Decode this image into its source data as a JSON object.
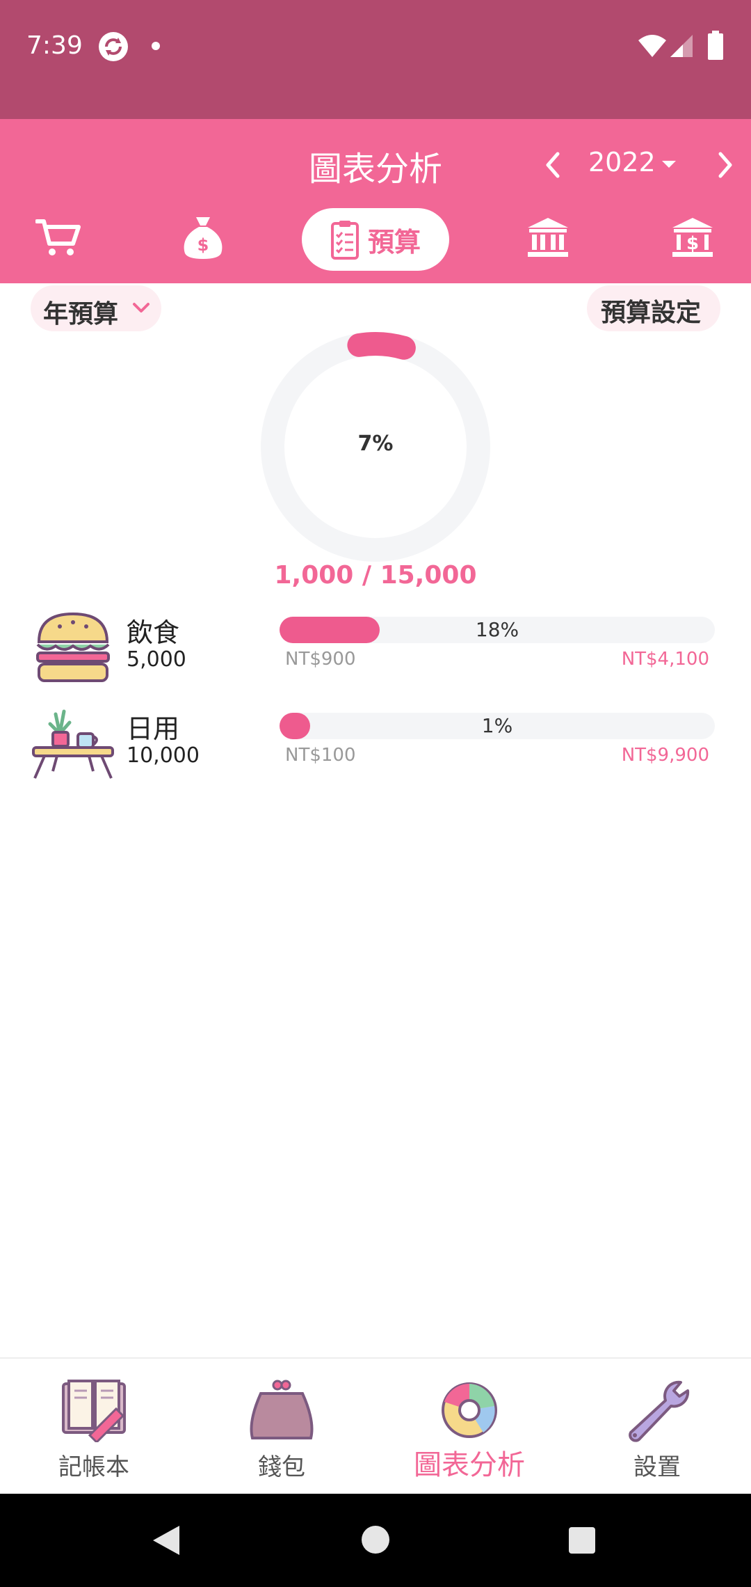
{
  "status_bar": {
    "time": "7:39"
  },
  "header": {
    "title": "圖表分析",
    "year": "2022",
    "tabs": [
      {
        "icon": "shopping-cart-icon"
      },
      {
        "icon": "money-bag-icon"
      },
      {
        "icon": "clipboard-checklist-icon",
        "label": "預算",
        "active": true
      },
      {
        "icon": "bank-icon"
      },
      {
        "icon": "bank-dollar-icon"
      }
    ]
  },
  "filter": {
    "period_label": "年預算",
    "settings_label": "預算設定"
  },
  "summary": {
    "percent_label": "7%",
    "percent": 0.07,
    "totals": "1,000 / 15,000"
  },
  "budgets": [
    {
      "icon": "burger-icon",
      "name": "飲食",
      "amount": "5,000",
      "percent_label": "18%",
      "fill": 0.23,
      "spent": "NT$900",
      "remaining": "NT$4,100"
    },
    {
      "icon": "table-plant-icon",
      "name": "日用",
      "amount": "10,000",
      "percent_label": "1%",
      "fill": 0.01,
      "spent": "NT$100",
      "remaining": "NT$9,900"
    }
  ],
  "bottom_nav": [
    {
      "icon": "notebook-icon",
      "label": "記帳本"
    },
    {
      "icon": "purse-icon",
      "label": "錢包"
    },
    {
      "icon": "donut-chart-icon",
      "label": "圖表分析",
      "active": true
    },
    {
      "icon": "wrench-icon",
      "label": "設置"
    }
  ],
  "colors": {
    "accent": "#f26796",
    "status_bar": "#b24a6e",
    "bar_fill": "#ee5b8e"
  }
}
